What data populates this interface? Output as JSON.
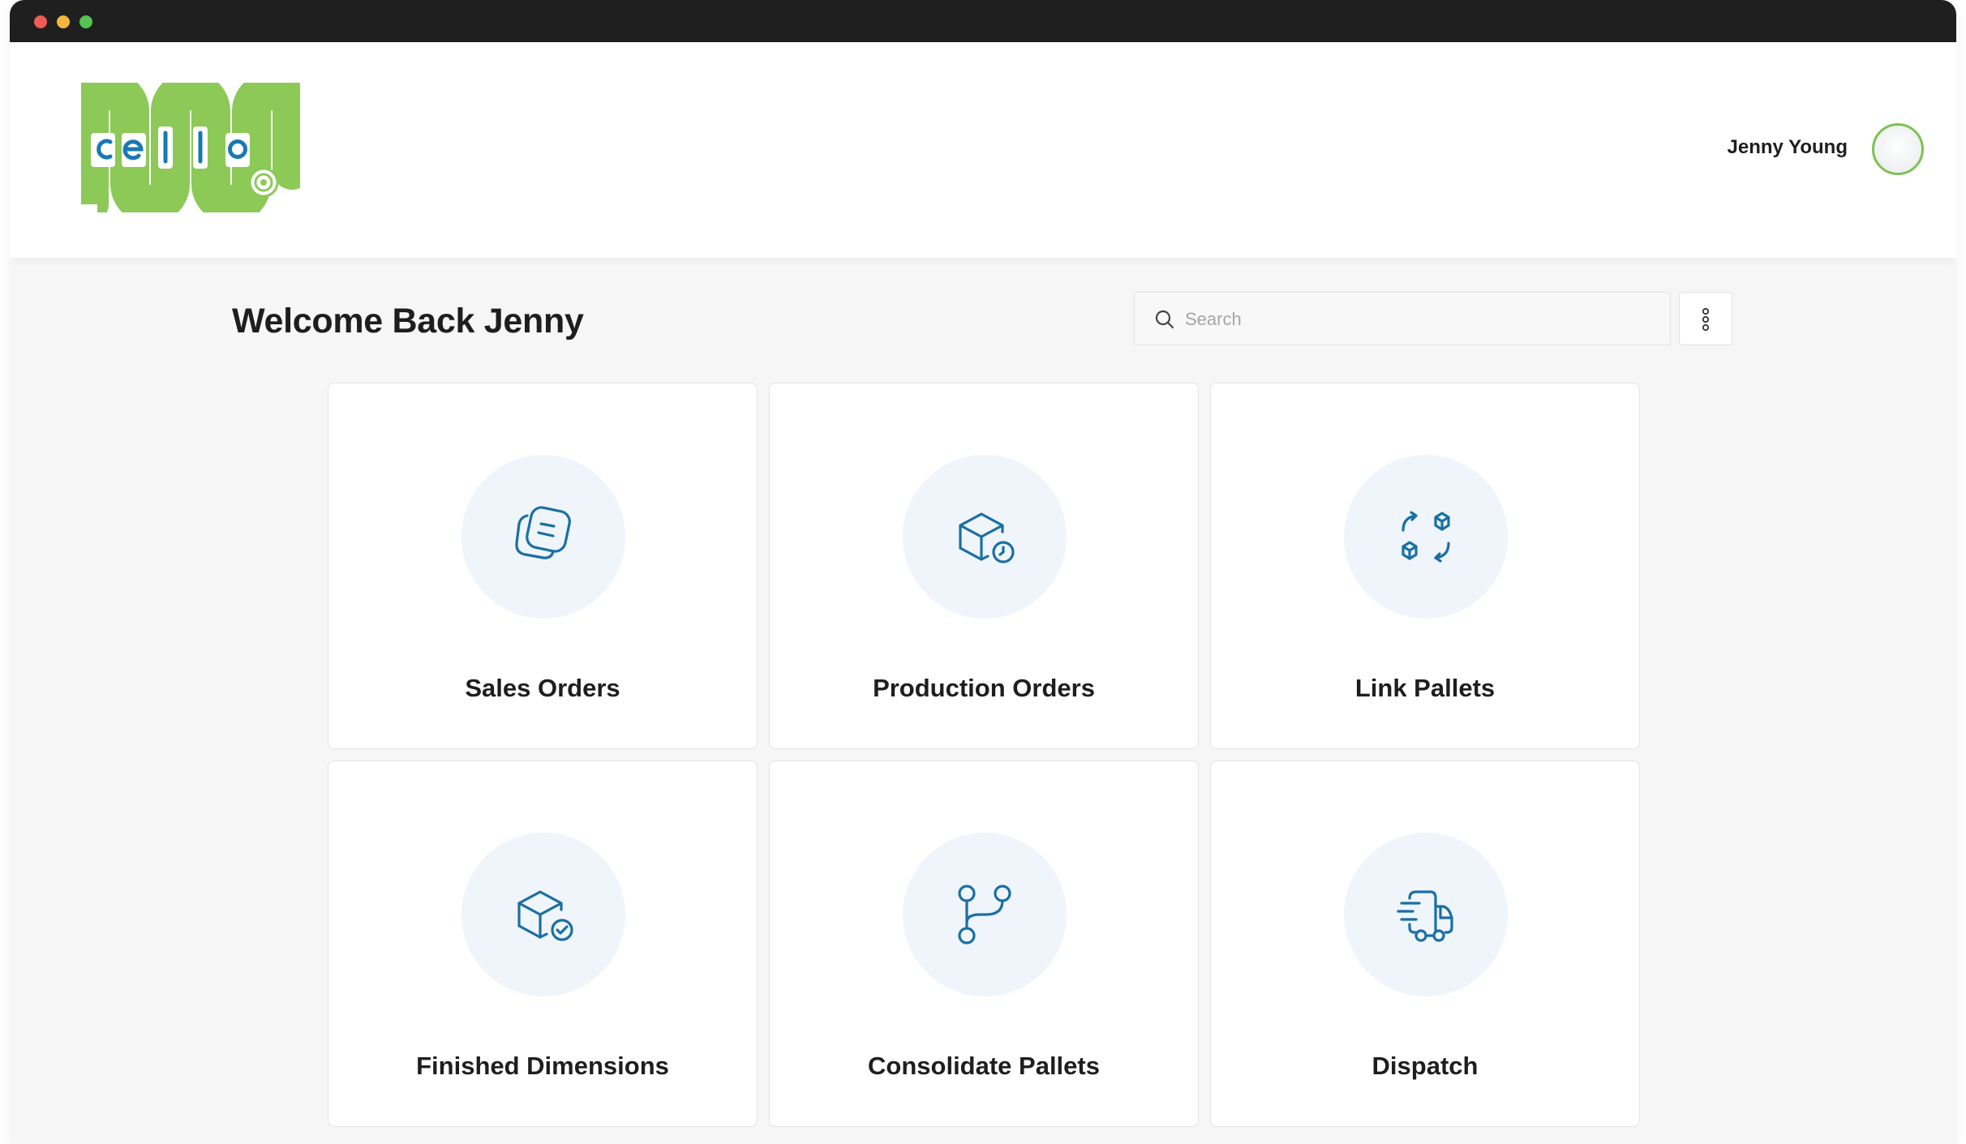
{
  "header": {
    "logo_text": "cello",
    "user_name": "Jenny Young"
  },
  "main": {
    "welcome": "Welcome Back Jenny",
    "search": {
      "placeholder": "Search"
    }
  },
  "cards": [
    {
      "label": "Sales Orders",
      "icon": "sales-orders-icon"
    },
    {
      "label": "Production Orders",
      "icon": "production-orders-icon"
    },
    {
      "label": "Link Pallets",
      "icon": "link-pallets-icon"
    },
    {
      "label": "Finished Dimensions",
      "icon": "finished-dimensions-icon"
    },
    {
      "label": "Consolidate Pallets",
      "icon": "consolidate-pallets-icon"
    },
    {
      "label": "Dispatch",
      "icon": "dispatch-icon"
    }
  ],
  "colors": {
    "brand_green": "#8cc957",
    "brand_blue": "#1a78b4",
    "icon_blue": "#1b6fa3",
    "icon_circle_bg": "#eff5fb"
  }
}
